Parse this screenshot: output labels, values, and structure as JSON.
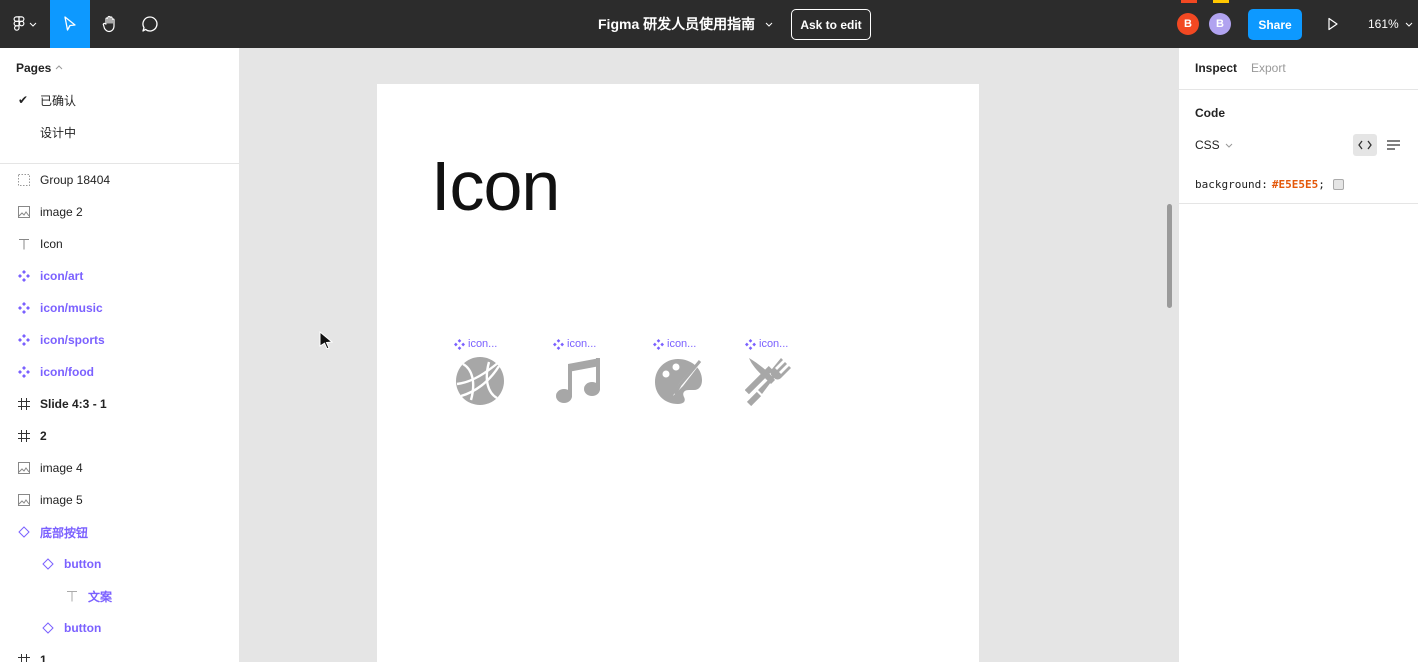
{
  "toolbar": {
    "file_title": "Figma 研发人员使用指南",
    "ask_to_edit_label": "Ask to edit",
    "share_label": "Share",
    "zoom_level": "161%",
    "avatars": [
      {
        "initial": "B",
        "color": "#f24822"
      },
      {
        "initial": "B",
        "color": "#b1a3f0"
      }
    ]
  },
  "pages": {
    "heading": "Pages",
    "items": [
      {
        "label": "已确认",
        "selected": true
      },
      {
        "label": "设计中",
        "selected": false
      }
    ]
  },
  "layers": [
    {
      "label": "Group 18404",
      "icon": "group-icon",
      "style": "normal"
    },
    {
      "label": "image 2",
      "icon": "image-icon",
      "style": "normal"
    },
    {
      "label": "Icon",
      "icon": "text-icon",
      "style": "normal"
    },
    {
      "label": "icon/art",
      "icon": "component-icon",
      "style": "component"
    },
    {
      "label": "icon/music",
      "icon": "component-icon",
      "style": "component"
    },
    {
      "label": "icon/sports",
      "icon": "component-icon",
      "style": "component"
    },
    {
      "label": "icon/food",
      "icon": "component-icon",
      "style": "component"
    },
    {
      "label": "Slide 4:3 - 1",
      "icon": "frame-icon",
      "style": "bold"
    },
    {
      "label": "2",
      "icon": "frame-icon",
      "style": "bold"
    },
    {
      "label": "image 4",
      "icon": "image-icon",
      "style": "normal"
    },
    {
      "label": "image 5",
      "icon": "image-icon",
      "style": "normal"
    },
    {
      "label": "底部按钮",
      "icon": "instance-icon",
      "style": "component"
    },
    {
      "label": "button",
      "icon": "instance-icon",
      "style": "component"
    },
    {
      "label": "文案",
      "icon": "text-icon",
      "style": "component"
    },
    {
      "label": "button",
      "icon": "instance-icon",
      "style": "component"
    },
    {
      "label": "1",
      "icon": "frame-icon",
      "style": "bold"
    }
  ],
  "canvas": {
    "frame_title": "Icon",
    "icons": [
      {
        "label": "icon...",
        "glyph": "basketball-icon"
      },
      {
        "label": "icon...",
        "glyph": "music-note-icon"
      },
      {
        "label": "icon...",
        "glyph": "art-palette-icon"
      },
      {
        "label": "icon...",
        "glyph": "fork-knife-icon"
      }
    ]
  },
  "inspect": {
    "tabs": [
      "Inspect",
      "Export"
    ],
    "code_heading": "Code",
    "language": "CSS",
    "code_property": "background:",
    "code_value": "#E5E5E5",
    "code_terminator": ";"
  },
  "colors": {
    "toolbar_bg": "#2c2c2c",
    "accent": "#0d99ff",
    "component": "#7b61ff",
    "icon_gray": "#a7a7a7",
    "canvas_bg": "#e5e5e5"
  }
}
